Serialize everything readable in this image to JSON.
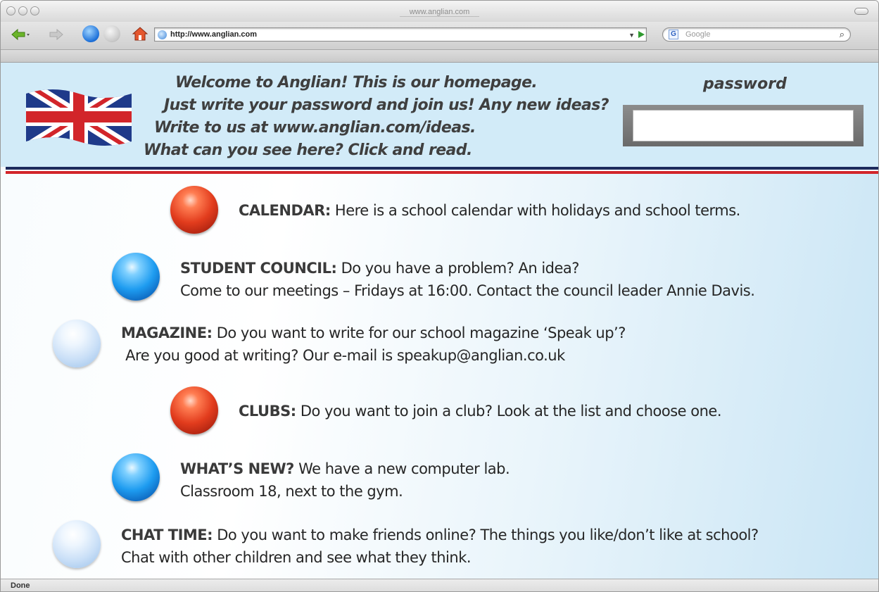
{
  "window": {
    "title": "www.anglian.com"
  },
  "toolbar": {
    "url": "http://www.anglian.com",
    "search_placeholder": "Google",
    "search_engine_icon": "G"
  },
  "header": {
    "welcome_lines": [
      "Welcome to Anglian! This is our homepage.",
      "Just write your password and join us! Any new ideas?",
      "Write to us at www.anglian.com/ideas.",
      "What can you see here? Click and read."
    ],
    "password_label": "password",
    "password_value": ""
  },
  "items": [
    {
      "bullet": "red",
      "title": "CALENDAR:",
      "lines": [
        "Here is a school calendar with holidays and school terms."
      ]
    },
    {
      "bullet": "blue",
      "title": "STUDENT COUNCIL:",
      "lines": [
        "Do you have a problem? An idea?",
        "Come to our meetings – Fridays at 16:00. Contact the council leader Annie Davis."
      ]
    },
    {
      "bullet": "pale",
      "title": "MAGAZINE:",
      "lines": [
        "Do you want to write for our school magazine ‘Speak up’?",
        " Are you good at writing? Our e-mail is speakup@anglian.co.uk"
      ]
    },
    {
      "bullet": "red",
      "title": "CLUBS:",
      "lines": [
        "Do you want to join a club? Look at the list and choose one."
      ]
    },
    {
      "bullet": "blue",
      "title": "WHAT’S NEW?",
      "lines": [
        "We have a new computer lab.",
        "Classroom 18, next to the gym."
      ]
    },
    {
      "bullet": "pale",
      "title": "CHAT TIME:",
      "lines": [
        "Do you want to make friends online? The things you like/don’t like at school?",
        "Chat with other children and see what they think."
      ]
    }
  ],
  "statusbar": {
    "text": "Done"
  },
  "colors": {
    "header_bg": "#d2ebf8",
    "stripe_navy": "#1c2a5c",
    "stripe_red": "#d2252a"
  },
  "icons": [
    "back-icon",
    "forward-icon",
    "reload-icon",
    "stop-icon",
    "home-icon",
    "globe-icon",
    "go-icon",
    "search-icon",
    "flag-icon",
    "bullet-icon"
  ]
}
